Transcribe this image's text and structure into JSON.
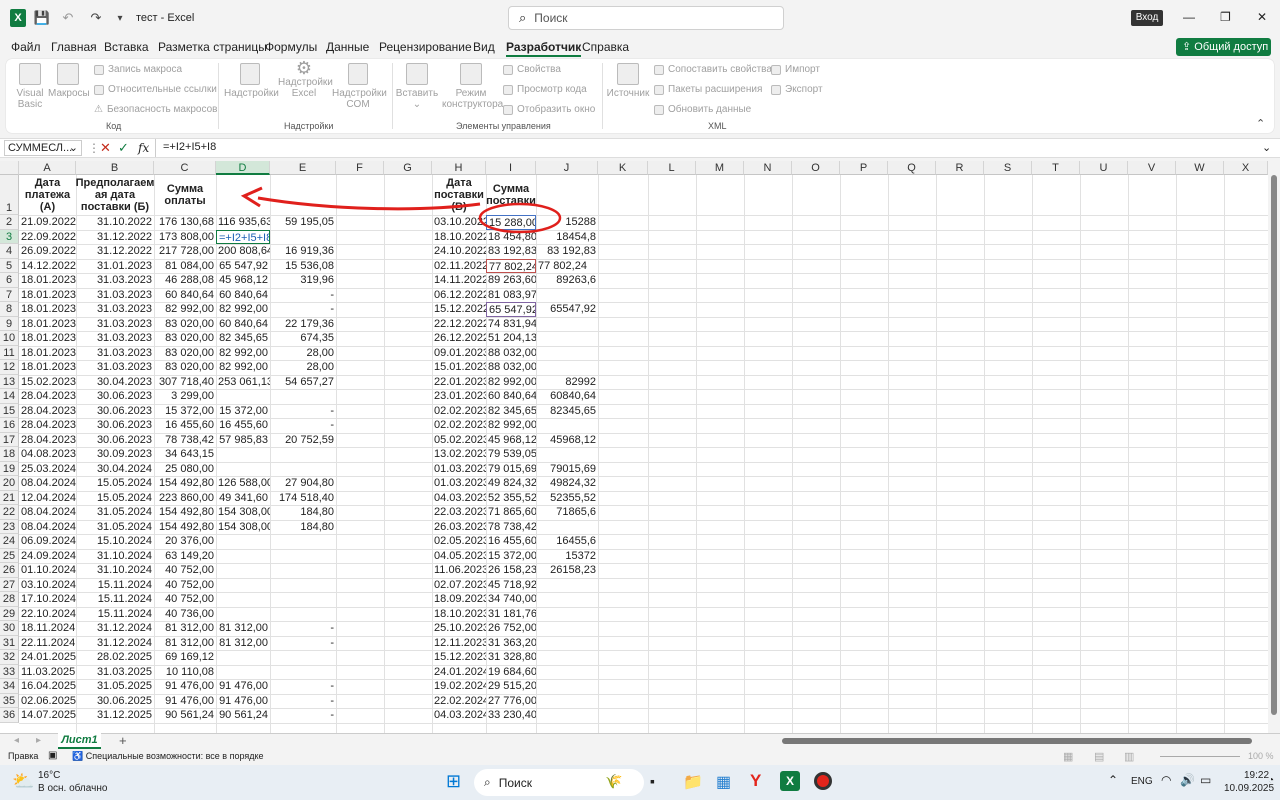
{
  "title": {
    "excel_icon": "X",
    "file": "тест",
    "separator": "-",
    "app": "Excel",
    "search_placeholder": "Поиск",
    "login": "Вход",
    "minimize": "—",
    "maximize": "❐",
    "close": "✕"
  },
  "menu": {
    "file": "Файл",
    "home": "Главная",
    "insert": "Вставка",
    "layout": "Разметка страницы",
    "formulas": "Формулы",
    "data": "Данные",
    "review": "Рецензирование",
    "view": "Вид",
    "developer": "Разработчик",
    "help": "Справка",
    "share": "Общий доступ"
  },
  "ribbon": {
    "vb": "Visual Basic",
    "macros": "Макросы",
    "rec": "Запись макроса",
    "rel": "Относительные ссылки",
    "sec": "Безопасность макросов",
    "code": "Код",
    "addins": "Надстройки",
    "excel_addins": "Надстройки Excel",
    "com_addins": "Надстройки COM",
    "addins_group": "Надстройки",
    "insert": "Вставить",
    "design": "Режим конструктора",
    "props": "Свойства",
    "viewcode": "Просмотр кода",
    "dialog": "Отобразить окно",
    "controls": "Элементы управления",
    "source": "Источник",
    "mapprops": "Сопоставить свойства",
    "packs": "Пакеты расширения",
    "refresh": "Обновить данные",
    "import": "Импорт",
    "export": "Экспорт",
    "xml": "XML"
  },
  "formula_bar": {
    "namebox": "СУММЕСЛ...",
    "fx": "fx",
    "formula": "=+I2+I5+I8",
    "cancel": "✕",
    "enter": "✓"
  },
  "columns": [
    "A",
    "B",
    "C",
    "D",
    "E",
    "F",
    "G",
    "H",
    "I",
    "J",
    "K",
    "L",
    "M",
    "N",
    "O",
    "P",
    "Q",
    "R",
    "S",
    "T",
    "U",
    "V",
    "W",
    "X"
  ],
  "header_row": {
    "a": "Дата платежа (А)",
    "b": "Предполагаем ая дата поставки (Б)",
    "c": "Сумма оплаты",
    "h": "Дата поставки (В)",
    "i": "Сумма поставки"
  },
  "rows": [
    {
      "n": "2",
      "a": "21.09.2022",
      "b": "31.10.2022",
      "c": "176 130,68",
      "d": "116 935,63",
      "e": "59 195,05",
      "h": "03.10.2022",
      "i": "15 288,00",
      "j": "15288"
    },
    {
      "n": "3",
      "a": "22.09.2022",
      "b": "31.12.2022",
      "c": "173 808,00",
      "d": "=+I2+I5+I8",
      "e": "",
      "h": "18.10.2022",
      "i": "18 454,80",
      "j": "18454,8"
    },
    {
      "n": "4",
      "a": "26.09.2022",
      "b": "31.12.2022",
      "c": "217 728,00",
      "d": "200 808,64",
      "e": "16 919,36",
      "h": "24.10.2022",
      "i": "83 192,83",
      "j": "83 192,83"
    },
    {
      "n": "5",
      "a": "14.12.2022",
      "b": "31.01.2023",
      "c": "81 084,00",
      "d": "65 547,92",
      "e": "15 536,08",
      "h": "02.11.2022",
      "i": "77 802,24",
      "j": "77 802,24"
    },
    {
      "n": "6",
      "a": "18.01.2023",
      "b": "31.03.2023",
      "c": "46 288,08",
      "d": "45 968,12",
      "e": "319,96",
      "h": "14.11.2022",
      "i": "89 263,60",
      "j": "89263,6"
    },
    {
      "n": "7",
      "a": "18.01.2023",
      "b": "31.03.2023",
      "c": "60 840,64",
      "d": "60 840,64",
      "e": "-",
      "h": "06.12.2022",
      "i": "81 083,97",
      "j": ""
    },
    {
      "n": "8",
      "a": "18.01.2023",
      "b": "31.03.2023",
      "c": "82 992,00",
      "d": "82 992,00",
      "e": "-",
      "h": "15.12.2022",
      "i": "65 547,92",
      "j": "65547,92"
    },
    {
      "n": "9",
      "a": "18.01.2023",
      "b": "31.03.2023",
      "c": "83 020,00",
      "d": "60 840,64",
      "e": "22 179,36",
      "h": "22.12.2022",
      "i": "74 831,94",
      "j": ""
    },
    {
      "n": "10",
      "a": "18.01.2023",
      "b": "31.03.2023",
      "c": "83 020,00",
      "d": "82 345,65",
      "e": "674,35",
      "h": "26.12.2022",
      "i": "51 204,13",
      "j": ""
    },
    {
      "n": "11",
      "a": "18.01.2023",
      "b": "31.03.2023",
      "c": "83 020,00",
      "d": "82 992,00",
      "e": "28,00",
      "h": "09.01.2023",
      "i": "88 032,00",
      "j": ""
    },
    {
      "n": "12",
      "a": "18.01.2023",
      "b": "31.03.2023",
      "c": "83 020,00",
      "d": "82 992,00",
      "e": "28,00",
      "h": "15.01.2023",
      "i": "88 032,00",
      "j": ""
    },
    {
      "n": "13",
      "a": "15.02.2023",
      "b": "30.04.2023",
      "c": "307 718,40",
      "d": "253 061,13",
      "e": "54 657,27",
      "h": "22.01.2023",
      "i": "82 992,00",
      "j": "82992"
    },
    {
      "n": "14",
      "a": "28.04.2023",
      "b": "30.06.2023",
      "c": "3 299,00",
      "d": "",
      "e": "",
      "h": "23.01.2023",
      "i": "60 840,64",
      "j": "60840,64"
    },
    {
      "n": "15",
      "a": "28.04.2023",
      "b": "30.06.2023",
      "c": "15 372,00",
      "d": "15 372,00",
      "e": "-",
      "h": "02.02.2023",
      "i": "82 345,65",
      "j": "82345,65"
    },
    {
      "n": "16",
      "a": "28.04.2023",
      "b": "30.06.2023",
      "c": "16 455,60",
      "d": "16 455,60",
      "e": "-",
      "h": "02.02.2023",
      "i": "82 992,00",
      "j": ""
    },
    {
      "n": "17",
      "a": "28.04.2023",
      "b": "30.06.2023",
      "c": "78 738,42",
      "d": "57 985,83",
      "e": "20 752,59",
      "h": "05.02.2023",
      "i": "45 968,12",
      "j": "45968,12"
    },
    {
      "n": "18",
      "a": "04.08.2023",
      "b": "30.09.2023",
      "c": "34 643,15",
      "d": "",
      "e": "",
      "h": "13.02.2023",
      "i": "79 539,05",
      "j": ""
    },
    {
      "n": "19",
      "a": "25.03.2024",
      "b": "30.04.2024",
      "c": "25 080,00",
      "d": "",
      "e": "",
      "h": "01.03.2023",
      "i": "79 015,69",
      "j": "79015,69"
    },
    {
      "n": "20",
      "a": "08.04.2024",
      "b": "15.05.2024",
      "c": "154 492,80",
      "d": "126 588,00",
      "e": "27 904,80",
      "h": "01.03.2023",
      "i": "49 824,32",
      "j": "49824,32"
    },
    {
      "n": "21",
      "a": "12.04.2024",
      "b": "15.05.2024",
      "c": "223 860,00",
      "d": "49 341,60",
      "e": "174 518,40",
      "h": "04.03.2023",
      "i": "52 355,52",
      "j": "52355,52"
    },
    {
      "n": "22",
      "a": "08.04.2024",
      "b": "31.05.2024",
      "c": "154 492,80",
      "d": "154 308,00",
      "e": "184,80",
      "h": "22.03.2023",
      "i": "71 865,60",
      "j": "71865,6"
    },
    {
      "n": "23",
      "a": "08.04.2024",
      "b": "31.05.2024",
      "c": "154 492,80",
      "d": "154 308,00",
      "e": "184,80",
      "h": "26.03.2023",
      "i": "78 738,42",
      "j": ""
    },
    {
      "n": "24",
      "a": "06.09.2024",
      "b": "15.10.2024",
      "c": "20 376,00",
      "d": "",
      "e": "",
      "h": "02.05.2023",
      "i": "16 455,60",
      "j": "16455,6"
    },
    {
      "n": "25",
      "a": "24.09.2024",
      "b": "31.10.2024",
      "c": "63 149,20",
      "d": "",
      "e": "",
      "h": "04.05.2023",
      "i": "15 372,00",
      "j": "15372"
    },
    {
      "n": "26",
      "a": "01.10.2024",
      "b": "31.10.2024",
      "c": "40 752,00",
      "d": "",
      "e": "",
      "h": "11.06.2023",
      "i": "26 158,23",
      "j": "26158,23"
    },
    {
      "n": "27",
      "a": "03.10.2024",
      "b": "15.11.2024",
      "c": "40 752,00",
      "d": "",
      "e": "",
      "h": "02.07.2023",
      "i": "45 718,92",
      "j": ""
    },
    {
      "n": "28",
      "a": "17.10.2024",
      "b": "15.11.2024",
      "c": "40 752,00",
      "d": "",
      "e": "",
      "h": "18.09.2023",
      "i": "34 740,00",
      "j": ""
    },
    {
      "n": "29",
      "a": "22.10.2024",
      "b": "15.11.2024",
      "c": "40 736,00",
      "d": "",
      "e": "",
      "h": "18.10.2023",
      "i": "31 181,76",
      "j": ""
    },
    {
      "n": "30",
      "a": "18.11.2024",
      "b": "31.12.2024",
      "c": "81 312,00",
      "d": "81 312,00",
      "e": "-",
      "h": "25.10.2023",
      "i": "26 752,00",
      "j": ""
    },
    {
      "n": "31",
      "a": "22.11.2024",
      "b": "31.12.2024",
      "c": "81 312,00",
      "d": "81 312,00",
      "e": "-",
      "h": "12.11.2023",
      "i": "31 363,20",
      "j": ""
    },
    {
      "n": "32",
      "a": "24.01.2025",
      "b": "28.02.2025",
      "c": "69 169,12",
      "d": "",
      "e": "",
      "h": "15.12.2023",
      "i": "31 328,80",
      "j": ""
    },
    {
      "n": "33",
      "a": "11.03.2025",
      "b": "31.03.2025",
      "c": "10 110,08",
      "d": "",
      "e": "",
      "h": "24.01.2024",
      "i": "19 684,60",
      "j": ""
    },
    {
      "n": "34",
      "a": "16.04.2025",
      "b": "31.05.2025",
      "c": "91 476,00",
      "d": "91 476,00",
      "e": "-",
      "h": "19.02.2024",
      "i": "29 515,20",
      "j": ""
    },
    {
      "n": "35",
      "a": "02.06.2025",
      "b": "30.06.2025",
      "c": "91 476,00",
      "d": "91 476,00",
      "e": "-",
      "h": "22.02.2024",
      "i": "27 776,00",
      "j": ""
    },
    {
      "n": "36",
      "a": "14.07.2025",
      "b": "31.12.2025",
      "c": "90 561,24",
      "d": "90 561,24",
      "e": "-",
      "h": "04.03.2024",
      "i": "33 230,40",
      "j": ""
    }
  ],
  "sheet": {
    "tab": "Лист1",
    "add": "+"
  },
  "status": {
    "mode": "Правка",
    "access": "Специальные возможности: все в порядке",
    "zoom": "100 %"
  },
  "taskbar": {
    "temp": "16°C",
    "weather": "В осн. облачно",
    "search": "Поиск",
    "lang": "ENG",
    "time": "19:22",
    "date": "10.09.2025"
  },
  "colors": {
    "excel_green": "#107c41",
    "annotation_red": "#e0201c"
  }
}
